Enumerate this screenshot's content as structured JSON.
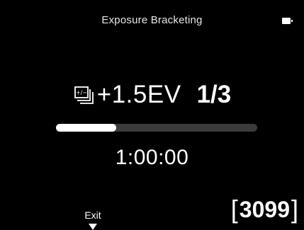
{
  "header": {
    "title": "Exposure Bracketing",
    "battery_icon": "battery-icon"
  },
  "bracketing": {
    "icon": "exposure-bracket-icon",
    "ev_value": "+1.5EV",
    "frame_count": "1/3"
  },
  "progress": {
    "fraction": 0.3
  },
  "timer": {
    "value": "1:00:00"
  },
  "footer": {
    "exit_label": "Exit",
    "exit_arrow_icon": "triangle-down-icon",
    "shots_open": "[",
    "shots_remaining": "3099",
    "shots_close": "]"
  },
  "colors": {
    "background": "#000000",
    "foreground": "#ffffff",
    "track": "#3b3b3b"
  }
}
